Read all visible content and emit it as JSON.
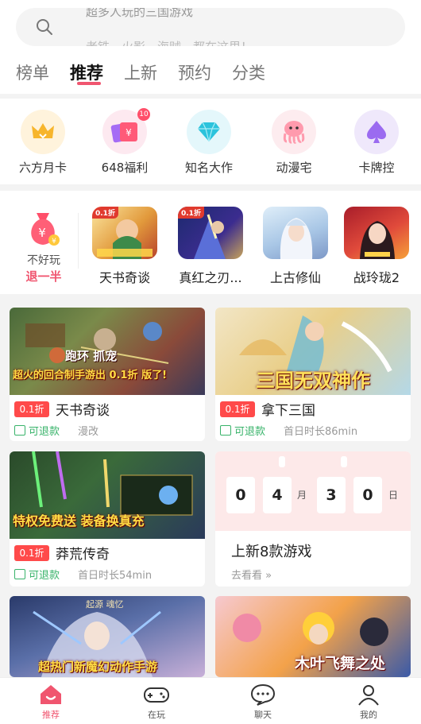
{
  "search": {
    "line1": "超多人玩的三国游戏",
    "line2": "老铁，火影，海贼，都在这里！"
  },
  "tabs": [
    "榜单",
    "推荐",
    "上新",
    "预约",
    "分类"
  ],
  "active_tab": "推荐",
  "categories": [
    {
      "label": "六方月卡",
      "icon": "crown-icon"
    },
    {
      "label": "648福利",
      "icon": "ticket-icon",
      "badge": "10"
    },
    {
      "label": "知名大作",
      "icon": "diamond-icon"
    },
    {
      "label": "动漫宅",
      "icon": "octopus-icon"
    },
    {
      "label": "卡牌控",
      "icon": "spade-icon"
    }
  ],
  "promo": {
    "line1": "不好玩",
    "line2": "退一半"
  },
  "featured": [
    "天书奇谈",
    "真红之刃...",
    "上古修仙",
    "战玲珑2"
  ],
  "featured_tags": [
    "0.1折",
    "0.1折"
  ],
  "cards": [
    {
      "caption": "超火的回合制手游出 0.1折 版了!",
      "overlay": "跑环  抓宠",
      "discount": "0.1折",
      "title": "天书奇谈",
      "refund": "可退款",
      "meta": "漫改"
    },
    {
      "caption": "三国无双神作",
      "discount": "0.1折",
      "title": "拿下三国",
      "refund": "可退款",
      "meta": "首日时长86min"
    },
    {
      "caption": "特权免费送 装备换真充",
      "discount": "0.1折",
      "title": "莽荒传奇",
      "refund": "可退款",
      "meta": "首日时长54min"
    },
    {
      "caption": "超热门新魔幻动作手游",
      "overlay": "起源 魂忆"
    },
    {
      "caption": "木叶飞舞之处"
    }
  ],
  "countdown": {
    "digits": [
      "0",
      "4",
      "3",
      "0"
    ],
    "unit_month": "月",
    "unit_day": "日",
    "title": "上新8款游戏",
    "link": "去看看 »"
  },
  "nav": [
    {
      "label": "推荐",
      "icon": "home-icon"
    },
    {
      "label": "在玩",
      "icon": "gamepad-icon"
    },
    {
      "label": "聊天",
      "icon": "chat-icon"
    },
    {
      "label": "我的",
      "icon": "profile-icon"
    }
  ],
  "colors": {
    "accent": "#f0556f",
    "discount": "#ff4a4a",
    "refund": "#38b36a"
  }
}
